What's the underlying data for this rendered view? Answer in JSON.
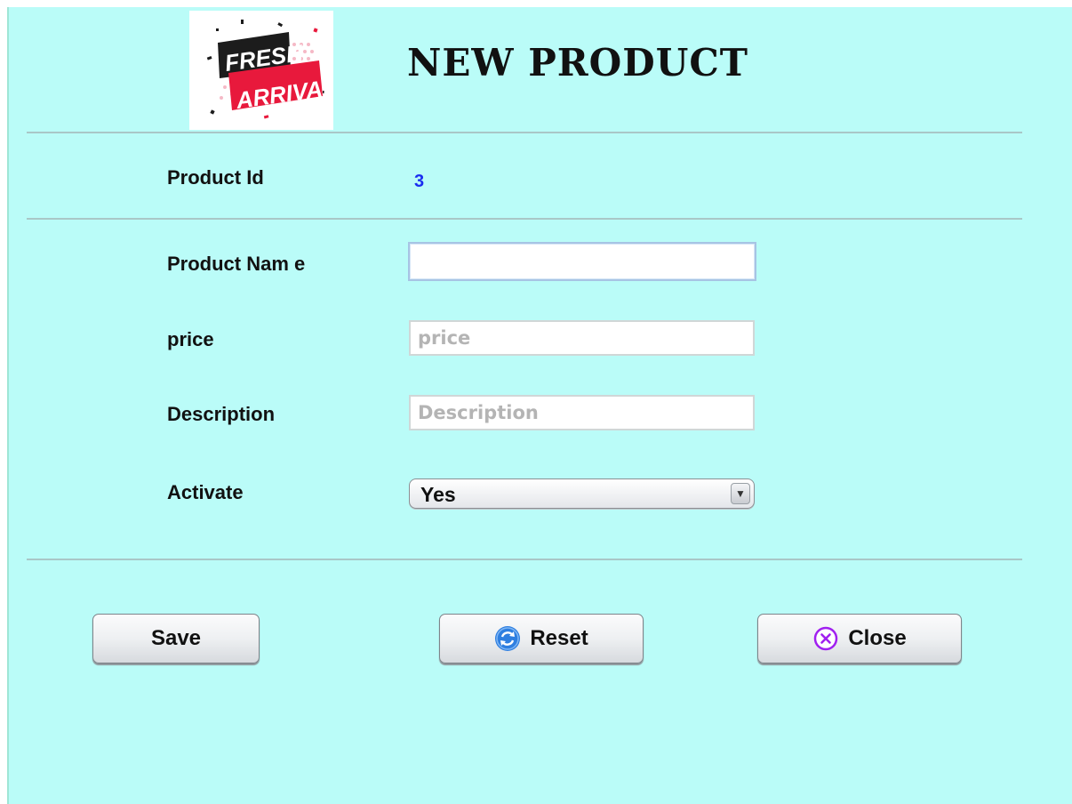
{
  "window": {
    "title": "NEW PRODUCT"
  },
  "logo": {
    "line1": "FRESH",
    "line2": "ARRIVAL",
    "colors": {
      "dark": "#1c1c1c",
      "red": "#e8193c"
    }
  },
  "form": {
    "product_id": {
      "label": "Product Id",
      "value": "3"
    },
    "product_name": {
      "label": "Product Nam e",
      "value": "",
      "placeholder": ""
    },
    "price": {
      "label": "price",
      "value": "",
      "placeholder": "price"
    },
    "description": {
      "label": "Description",
      "value": "",
      "placeholder": "Description"
    },
    "activate": {
      "label": "Activate",
      "selected": "Yes"
    }
  },
  "buttons": {
    "save": {
      "label": "Save"
    },
    "reset": {
      "label": "Reset",
      "icon": "refresh-icon"
    },
    "close": {
      "label": "Close",
      "icon": "close-circle-icon"
    }
  },
  "colors": {
    "background": "#bafcf8",
    "id_value": "#1a2df0",
    "reset_icon": "#2f7fe0",
    "close_icon": "#a020f0"
  }
}
